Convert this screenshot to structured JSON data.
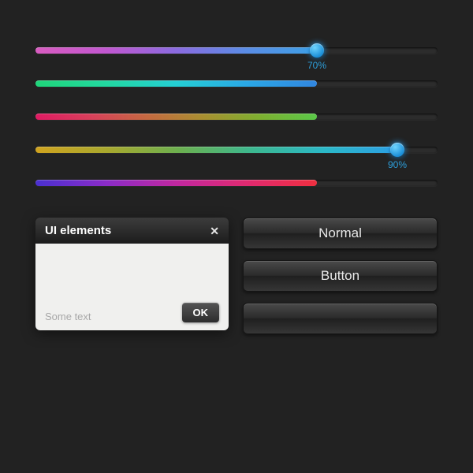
{
  "sliders": [
    {
      "percent": 70,
      "show_thumb": true,
      "show_label": true,
      "label": "70%",
      "gradient": "g1"
    },
    {
      "percent": 70,
      "show_thumb": false,
      "show_label": false,
      "label": "",
      "gradient": "g2"
    },
    {
      "percent": 70,
      "show_thumb": false,
      "show_label": false,
      "label": "",
      "gradient": "g3"
    },
    {
      "percent": 90,
      "show_thumb": true,
      "show_label": true,
      "label": "90%",
      "gradient": "g4"
    },
    {
      "percent": 70,
      "show_thumb": false,
      "show_label": false,
      "label": "",
      "gradient": "g5"
    }
  ],
  "dialog": {
    "title": "UI elements",
    "hint": "Some text",
    "ok": "OK",
    "close": "✕"
  },
  "buttons": {
    "normal": "Normal",
    "button": "Button",
    "empty": ""
  },
  "colors": {
    "accent": "#2da0dd",
    "bg": "#222222"
  }
}
